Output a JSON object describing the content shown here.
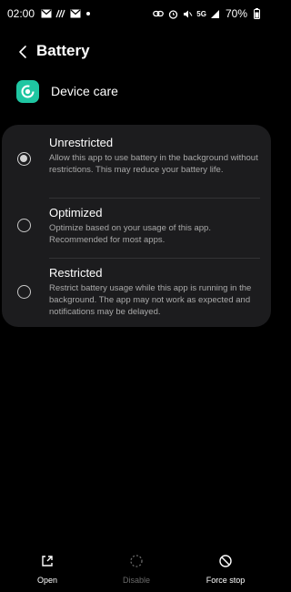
{
  "status_bar": {
    "time": "02:00",
    "network": "5G",
    "battery": "70%",
    "left_icons": [
      "mail-icon",
      "wifi-calling-icon",
      "mail-icon",
      "dot-icon"
    ],
    "right_icons": [
      "link-icon",
      "alarm-icon",
      "mute-icon",
      "5g-icon",
      "signal-icon",
      "battery-icon"
    ]
  },
  "header": {
    "title": "Battery",
    "back_icon": "back-arrow-icon"
  },
  "app": {
    "name": "Device care",
    "icon": "device-care-icon",
    "icon_color": "#1fc6a2"
  },
  "options": [
    {
      "title": "Unrestricted",
      "description": "Allow this app to use battery in the background without restrictions. This may reduce your battery life.",
      "selected": true
    },
    {
      "title": "Optimized",
      "description": "Optimize based on your usage of this app. Recommended for most apps.",
      "selected": false
    },
    {
      "title": "Restricted",
      "description": "Restrict battery usage while this app is running in the background. The app may not work as expected and notifications may be delayed.",
      "selected": false
    }
  ],
  "bottom_actions": [
    {
      "label": "Open",
      "icon": "open-external-icon",
      "enabled": true
    },
    {
      "label": "Disable",
      "icon": "disable-icon",
      "enabled": false
    },
    {
      "label": "Force stop",
      "icon": "force-stop-icon",
      "enabled": true
    }
  ],
  "colors": {
    "background": "#000000",
    "card": "#1c1c1e",
    "secondary_text": "#a9a9a9",
    "disabled_text": "#6a6a6a"
  }
}
